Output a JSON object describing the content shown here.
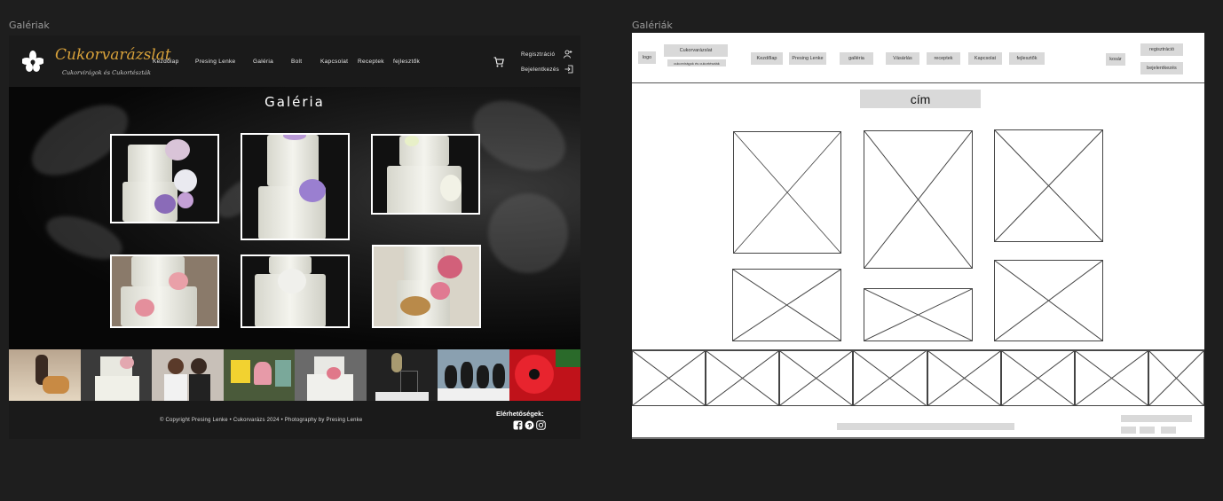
{
  "frames": {
    "left_label": "Galériak",
    "right_label": "Galériák"
  },
  "design": {
    "brand": {
      "name": "Cukorvarázslat",
      "tagline": "Cukorvirágok és Cukortészták"
    },
    "nav": [
      "Kezdőlap",
      "Presing Lenke",
      "Galéria",
      "Bolt",
      "Kapcsolat",
      "Receptek",
      "fejlesztők"
    ],
    "auth": {
      "register": "Regisztráció",
      "login": "Bejelentkezés"
    },
    "gallery_title": "Galéria",
    "footer": {
      "copyright": "© Copyright Presing Lenke • Cukorvarázs 2024 • Photography by Presing Lenke",
      "contact_title": "Elérhetőségek:",
      "social_icons": [
        "facebook-icon",
        "pinterest-icon",
        "instagram-icon"
      ]
    },
    "colors": {
      "brand": "#d9a23a",
      "header": "#1a1a1a",
      "background": "#000000"
    }
  },
  "wireframe": {
    "logo": "logo",
    "brand": "Cukorvarázslat",
    "tagline": "cukorvirágok és cukortészták",
    "nav": [
      "Kezdőlap",
      "Presing Lenke",
      "galléria",
      "Vásárlás",
      "receptek",
      "Kapcsolat",
      "fejlesztők"
    ],
    "cart": "kosár",
    "register": "regisztráció",
    "login": "bejelentkezés",
    "title": "cím"
  }
}
